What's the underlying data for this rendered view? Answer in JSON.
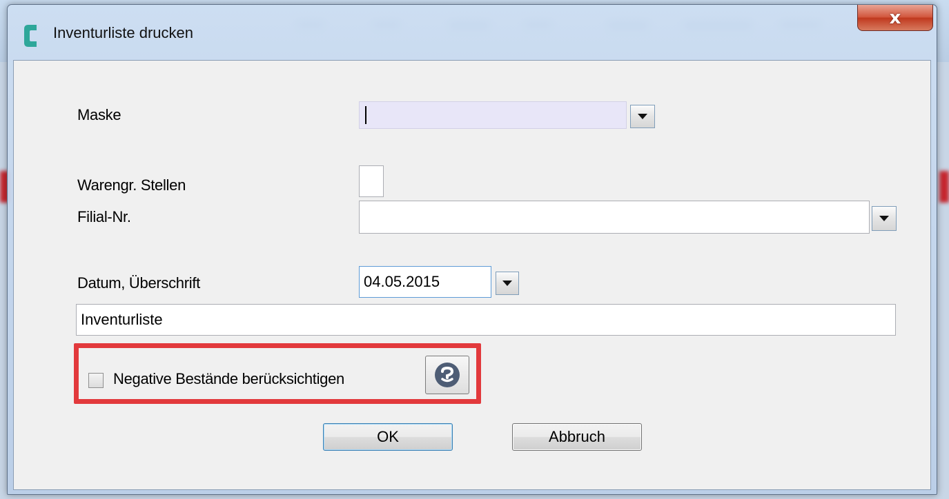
{
  "window": {
    "title": "Inventurliste drucken",
    "close_glyph": "x"
  },
  "form": {
    "maske": {
      "label": "Maske",
      "value": ""
    },
    "warengr_stellen": {
      "label": "Warengr. Stellen",
      "value": ""
    },
    "filial_nr": {
      "label": "Filial-Nr.",
      "value": ""
    },
    "datum": {
      "label": "Datum, Überschrift",
      "value": "04.05.2015"
    },
    "ueberschrift": {
      "value": "Inventurliste"
    },
    "negative_bestaende": {
      "label": "Negative Bestände berücksichtigen",
      "checked": false
    }
  },
  "buttons": {
    "ok": "OK",
    "abbruch": "Abbruch"
  },
  "colors": {
    "highlight": "#e2393c",
    "maske_field_bg": "#e8e6f8",
    "help_icon": "#4e5d75",
    "app_icon": "#2ea79a"
  },
  "icons": {
    "app": "c-logo-icon",
    "help": "question-icon",
    "dropdown": "dropdown-arrow-icon",
    "close": "close-icon"
  }
}
